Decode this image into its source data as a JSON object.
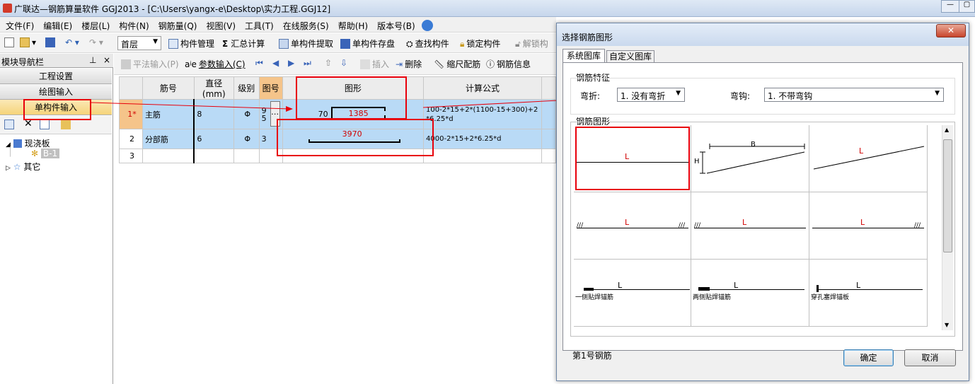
{
  "titlebar": {
    "title": "广联达—钢筋算量软件 GGJ2013 - [C:\\Users\\yangx-e\\Desktop\\实力工程.GGJ12]"
  },
  "menu": [
    "文件(F)",
    "编辑(E)",
    "楼层(L)",
    "构件(N)",
    "钢筋量(Q)",
    "视图(V)",
    "工具(T)",
    "在线服务(S)",
    "帮助(H)",
    "版本号(B)"
  ],
  "toolbar1": {
    "floor": "首层",
    "component_mgmt": "构件管理",
    "summary": "汇总计算",
    "extract": "单构件提取",
    "save_disk": "单构件存盘",
    "find": "查找构件",
    "lock": "锁定构件",
    "unlock": "解锁构"
  },
  "nav": {
    "title": "模块导航栏",
    "pin": "ᵖ",
    "close": "×",
    "project_settings": "工程设置",
    "drawing_input": "绘图输入",
    "single_input": "单构件输入"
  },
  "tree": {
    "root": "现浇板",
    "child": "B-1",
    "other": "其它"
  },
  "toolbar2": {
    "flat_input": "平法输入(P)",
    "param_input": "参数输入(C)",
    "insert": "插入",
    "delete": "删除",
    "scale": "缩尺配筋",
    "rebar_info": "钢筋信息"
  },
  "grid": {
    "headers": [
      "筋号",
      "直径(mm)",
      "级别",
      "图号",
      "图形",
      "计算公式"
    ],
    "rows": [
      {
        "num": "1*",
        "name": "主筋",
        "dia": "8",
        "grade": "Φ",
        "fig_a": "9",
        "fig_b": "5",
        "dim_left": "70",
        "dim_len": "1385",
        "formula1": "100-2*15+2*(1100-15+300)+2",
        "formula2": "*6.25*d"
      },
      {
        "num": "2",
        "name": "分部筋",
        "dia": "6",
        "grade": "Φ",
        "fig": "3",
        "dim_len": "3970",
        "formula1": "4000-2*15+2*6.25*d"
      },
      {
        "num": "3"
      }
    ]
  },
  "dialog": {
    "title": "选择钢筋图形",
    "tabs": [
      "系统图库",
      "自定义图库"
    ],
    "features_label": "钢筋特征",
    "bend_label": "弯折:",
    "bend_value": "1. 没有弯折",
    "hook_label": "弯钩:",
    "hook_value": "1. 不带弯钩",
    "shapes_label": "钢筋图形",
    "shapes": [
      {
        "label": "L",
        "caption": ""
      },
      {
        "label": "B",
        "label2": "H",
        "caption": ""
      },
      {
        "label": "L",
        "caption": ""
      },
      {
        "label": "L",
        "caption": ""
      },
      {
        "label": "L",
        "caption": ""
      },
      {
        "label": "L",
        "caption": ""
      },
      {
        "label": "L",
        "caption": "一侧贴焊锚筋"
      },
      {
        "label": "L",
        "caption": "两侧贴焊锚筋"
      },
      {
        "label": "L",
        "caption": "穿孔塞焊锚板"
      }
    ],
    "status": "第1号钢筋",
    "ok": "确定",
    "cancel": "取消"
  }
}
